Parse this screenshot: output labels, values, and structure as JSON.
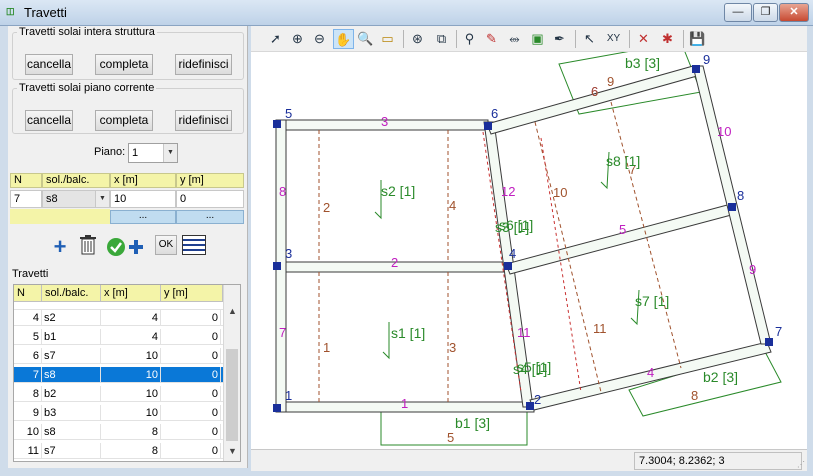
{
  "window": {
    "title": "Travetti",
    "app_icon": "eq-icon",
    "minimize": "—",
    "maximize": "❐",
    "close": "✕"
  },
  "group_struttura": {
    "legend": "Travetti solai intera struttura",
    "cancella": "cancella",
    "completa": "completa",
    "ridefinisci": "ridefinisci"
  },
  "group_piano": {
    "legend": "Travetti solai piano corrente",
    "cancella": "cancella",
    "completa": "completa",
    "ridefinisci": "ridefinisci"
  },
  "piano": {
    "label": "Piano:",
    "value": "1"
  },
  "edit_grid": {
    "headers": [
      "N",
      "sol./balc.",
      "x [m]",
      "y [m]"
    ],
    "row": {
      "n": "7",
      "sol": "s8",
      "x": "10",
      "y": "0"
    },
    "dots": "..."
  },
  "actions": {
    "ok": "OK"
  },
  "list": {
    "title": "Travetti",
    "headers": [
      "N",
      "sol./balc.",
      "x [m]",
      "y [m]"
    ],
    "rows": [
      {
        "n": "4",
        "sol": "s2",
        "x": "4",
        "y": "0"
      },
      {
        "n": "5",
        "sol": "b1",
        "x": "4",
        "y": "0"
      },
      {
        "n": "6",
        "sol": "s7",
        "x": "10",
        "y": "0"
      },
      {
        "n": "7",
        "sol": "s8",
        "x": "10",
        "y": "0",
        "selected": true
      },
      {
        "n": "8",
        "sol": "b2",
        "x": "10",
        "y": "0"
      },
      {
        "n": "9",
        "sol": "b3",
        "x": "10",
        "y": "0"
      },
      {
        "n": "10",
        "sol": "s8",
        "x": "8",
        "y": "0"
      },
      {
        "n": "11",
        "sol": "s7",
        "x": "8",
        "y": "0"
      }
    ]
  },
  "toolbar": {
    "tools": [
      "cursor-icon",
      "zoom-in-icon",
      "zoom-out-icon",
      "pan-hand-icon",
      "zoom-window-icon",
      "measure-icon",
      "zoom-extents-icon",
      "fit-window-icon",
      "link-icon",
      "color-fill-icon",
      "paint-icon",
      "image-icon",
      "pen-icon",
      "select-icon",
      "xy-icon",
      "delete-beam-icon",
      "delete-red-icon",
      "save-icon"
    ]
  },
  "drawing": {
    "slab_labels": [
      "s2 [1]",
      "s1 [1]",
      "s8 [1]",
      "s7 [1]",
      "s6 [1]",
      "s5 [1]",
      "s3 [1]",
      "s4 [1]"
    ],
    "balcony_labels": [
      "b1 [3]",
      "b2 [3]",
      "b3 [3]"
    ],
    "node_labels": [
      "1",
      "2",
      "3",
      "4",
      "5",
      "6",
      "7",
      "8",
      "9"
    ],
    "edge_labels": [
      "1",
      "2",
      "3",
      "4",
      "5",
      "6",
      "7",
      "8",
      "9",
      "10",
      "11",
      "12"
    ],
    "joist_labels": [
      "1",
      "2",
      "3",
      "4",
      "5",
      "6",
      "7",
      "8",
      "9",
      "10",
      "11"
    ]
  },
  "status": {
    "coords": "7.3004; 8.2362; 3"
  },
  "colors": {
    "structure": "#3a3a3a",
    "beam_fill": "#e8f4e8",
    "beam_edge": "#2a8a2a",
    "joist": "#a0522d",
    "dashed_red": "#c83030",
    "node": "#1a2f9a",
    "magenta_label": "#c020c0",
    "balcony": "#2a8a2a"
  }
}
